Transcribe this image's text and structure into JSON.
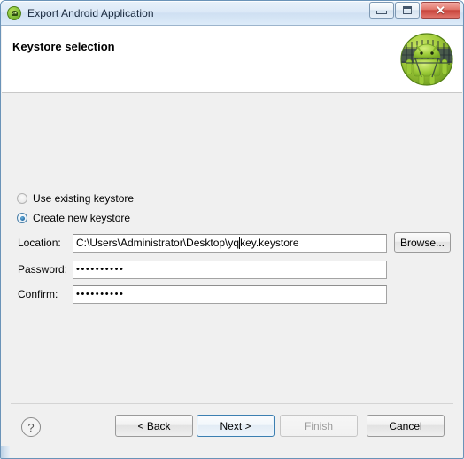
{
  "window": {
    "title": "Export Android Application",
    "app_icon": "android-icon",
    "controls": {
      "minimize": "minimize-icon",
      "maximize": "maximize-icon",
      "close": "✕"
    }
  },
  "header": {
    "title": "Keystore selection",
    "description": "",
    "image": "android-keystore-image"
  },
  "options": {
    "existing": {
      "label": "Use existing keystore",
      "selected": false
    },
    "create_new": {
      "label": "Create new keystore",
      "selected": true
    }
  },
  "fields": {
    "location": {
      "label": "Location:",
      "value_before_caret": "C:\\Users\\Administrator\\Desktop\\yq",
      "value_after_caret": "key.keystore",
      "full_value": "C:\\Users\\Administrator\\Desktop\\yqkey.keystore"
    },
    "password": {
      "label": "Password:",
      "masked_value": "••••••••••",
      "char_count": 10
    },
    "confirm": {
      "label": "Confirm:",
      "masked_value": "••••••••••",
      "char_count": 10
    }
  },
  "buttons": {
    "browse": "Browse...",
    "back": "< Back",
    "next": "Next >",
    "finish": "Finish",
    "cancel": "Cancel",
    "help": "?"
  },
  "state": {
    "finish_enabled": false,
    "default_button": "Next >"
  },
  "colors": {
    "accent_blue": "#3c7fb1",
    "android_green": "#8cc63f",
    "title_bar": "#dce9f7",
    "content_bg": "#f0f0f0",
    "close_red": "#c8453c"
  }
}
